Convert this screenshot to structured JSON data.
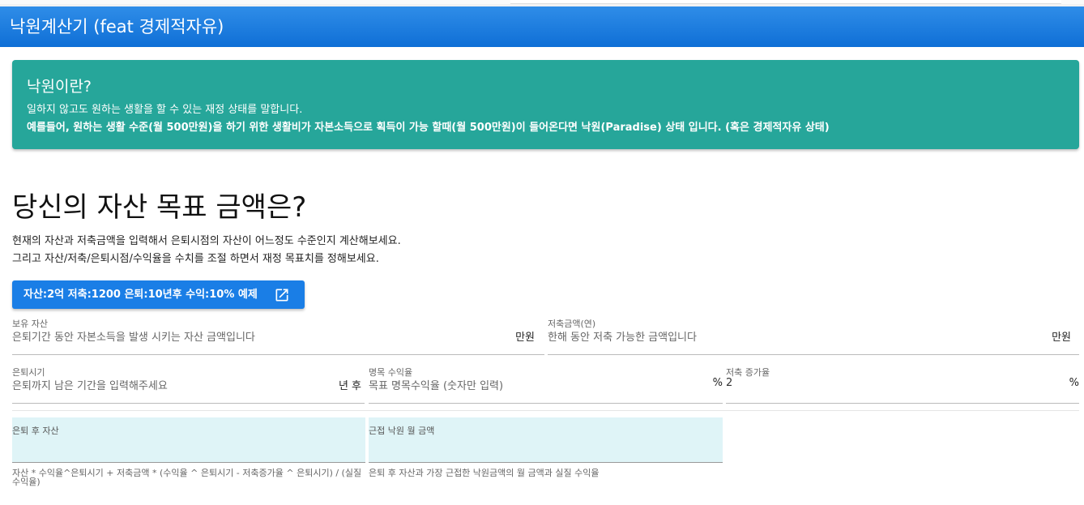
{
  "app": {
    "title": "낙원계산기 (feat 경제적자유)"
  },
  "banner": {
    "title": "낙원이란?",
    "line1": "일하지 않고도 원하는 생활을 할 수 있는 재정 상태를 말합니다.",
    "line2": "예를들어, 원하는 생활 수준(월 500만원)을 하기 위한 생활비가 자본소득으로 획득이 가능 할때(월 500만원)이 들어온다면 낙원(Paradise) 상태 입니다. (혹은 경제적자유 상태)"
  },
  "main": {
    "heading": "당신의 자산 목표 금액은?",
    "desc1": "현재의 자산과 저축금액을 입력해서 은퇴시점의 자산이 어느정도 수준인지 계산해보세요.",
    "desc2": "그리고 자산/저축/은퇴시점/수익율을 수치를 조절 하면서 재정 목표치를 정해보세요.",
    "example_button": "자산:2억 저축:1200 은퇴:10년후 수익:10% 예제"
  },
  "fields": {
    "assets": {
      "label": "보유 자산",
      "placeholder": "은퇴기간 동안 자본소득을 발생 시키는 자산 금액입니다",
      "unit": "만원"
    },
    "savings": {
      "label": "저축금액(연)",
      "placeholder": "한해 동안 저축 가능한 금액입니다",
      "unit": "만원"
    },
    "retire": {
      "label": "은퇴시기",
      "placeholder": "은퇴까지 남은 기간을 입력해주세요",
      "unit": "년 후"
    },
    "return_rate": {
      "label": "명목 수익율",
      "placeholder": "목표 명목수익율 (숫자만 입력)",
      "unit": "%"
    },
    "savings_growth": {
      "label": "저축 증가율",
      "value": "2",
      "unit": "%"
    }
  },
  "results": {
    "after_retire": {
      "label": "은퇴 후 자산",
      "hint": "자산 * 수익율^은퇴시기 + 저축금액 * (수익율 ^ 은퇴시기 - 저축증가율 ^ 은퇴시기) / (실질수익율)"
    },
    "closest_paradise": {
      "label": "근접 낙원 월 금액",
      "hint": "은퇴 후 자산과 가장 근접한 낙원금액의 월 금액과 실질 수익율"
    }
  },
  "colors": {
    "appbar": "#1a7ee6",
    "banner": "#26a69a",
    "button": "#1a7ee6",
    "result_bg": "#dff4f7"
  },
  "icons": {
    "example_button_icon": "open-in-new-icon"
  }
}
